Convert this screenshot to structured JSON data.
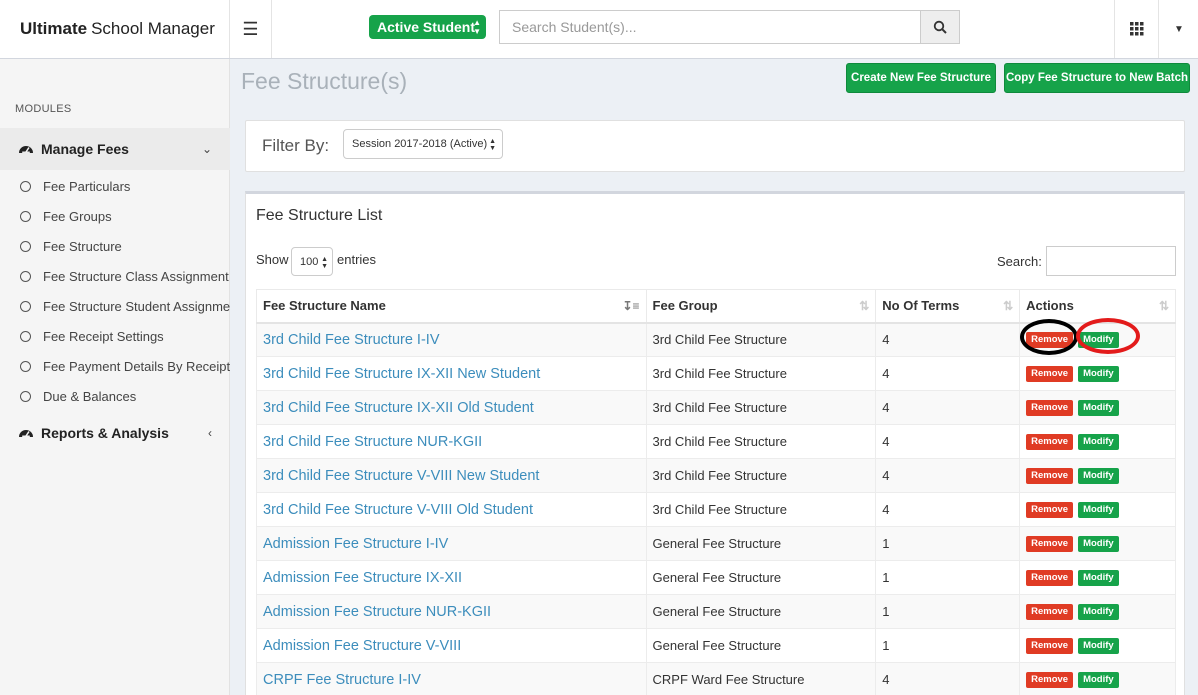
{
  "brand": {
    "bold": "Ultimate",
    "rest": "School Manager"
  },
  "header": {
    "student_filter": "Active Student",
    "search_placeholder": "Search Student(s)..."
  },
  "sidebar": {
    "modules_label": "MODULES",
    "manage_fees": {
      "label": "Manage Fees",
      "items": [
        "Fee Particulars",
        "Fee Groups",
        "Fee Structure",
        "Fee Structure Class Assignment",
        "Fee Structure Student Assignment",
        "Fee Receipt Settings",
        "Fee Payment Details By Receipt No",
        "Due & Balances"
      ]
    },
    "reports": {
      "label": "Reports & Analysis"
    }
  },
  "page": {
    "title": "Fee Structure(s)",
    "create_button": "Create New Fee Structure",
    "copy_button": "Copy Fee Structure to New Batch",
    "filter_label": "Filter By:",
    "session_value": "Session 2017-2018 (Active)"
  },
  "list": {
    "title": "Fee Structure List",
    "show_label": "Show",
    "entries_value": "100",
    "entries_label": "entries",
    "search_label": "Search:",
    "columns": [
      "Fee Structure Name",
      "Fee Group",
      "No Of Terms",
      "Actions"
    ],
    "remove_label": "Remove",
    "modify_label": "Modify",
    "rows": [
      {
        "name": "3rd Child Fee Structure I-IV",
        "group": "3rd Child Fee Structure",
        "terms": "4"
      },
      {
        "name": "3rd Child Fee Structure IX-XII New Student",
        "group": "3rd Child Fee Structure",
        "terms": "4"
      },
      {
        "name": "3rd Child Fee Structure IX-XII Old Student",
        "group": "3rd Child Fee Structure",
        "terms": "4"
      },
      {
        "name": "3rd Child Fee Structure NUR-KGII",
        "group": "3rd Child Fee Structure",
        "terms": "4"
      },
      {
        "name": "3rd Child Fee Structure V-VIII New Student",
        "group": "3rd Child Fee Structure",
        "terms": "4"
      },
      {
        "name": "3rd Child Fee Structure V-VIII Old Student",
        "group": "3rd Child Fee Structure",
        "terms": "4"
      },
      {
        "name": "Admission Fee Structure I-IV",
        "group": "General Fee Structure",
        "terms": "1"
      },
      {
        "name": "Admission Fee Structure IX-XII",
        "group": "General Fee Structure",
        "terms": "1"
      },
      {
        "name": "Admission Fee Structure NUR-KGII",
        "group": "General Fee Structure",
        "terms": "1"
      },
      {
        "name": "Admission Fee Structure V-VIII",
        "group": "General Fee Structure",
        "terms": "1"
      },
      {
        "name": "CRPF Fee Structure I-IV",
        "group": "CRPF Ward Fee Structure",
        "terms": "4"
      }
    ]
  },
  "colors": {
    "accent_green": "#16a34a",
    "remove_red": "#e03b24",
    "link_blue": "#3c8dbc",
    "annotation_black": "#000000",
    "annotation_red": "#e31b1b"
  }
}
